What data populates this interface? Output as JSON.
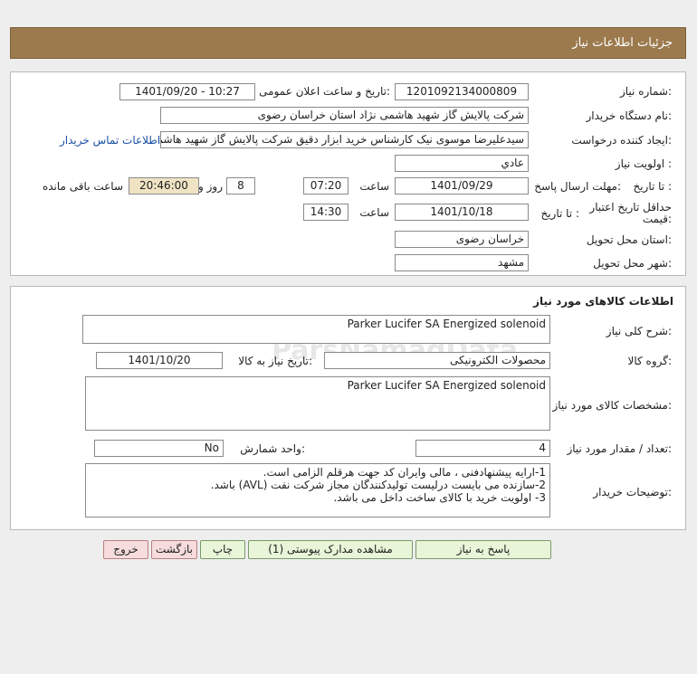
{
  "page_title": "جزئیات اطلاعات نیاز",
  "info": {
    "need_number_label": "شماره نیاز:",
    "need_number": "1201092134000809",
    "announce_label": "تاریخ و ساعت اعلان عمومی:",
    "announce_value": "1401/09/20 - 10:27",
    "buyer_label": "نام دستگاه خریدار:",
    "buyer_value": "شرکت پالایش گاز شهید هاشمی نژاد   استان خراسان رضوی",
    "creator_label": "ایجاد کننده درخواست:",
    "creator_value": "سیدعلیرضا موسوی نیک کارشناس خرید ابزار دقیق شرکت پالایش گاز شهید هاشمی نژاد",
    "contact_link": "اطلاعات تماس خریدار",
    "priority_label": "اولویت نیاز :",
    "priority_value": "عادي",
    "deadline_label": "مهلت ارسال پاسخ:",
    "until_date_label": "تا تاریخ :",
    "deadline_date": "1401/09/29",
    "time_label": "ساعت",
    "deadline_time": "07:20",
    "days_value": "8",
    "days_label": "روز و",
    "remaining_time": "20:46:00",
    "remaining_label": "ساعت باقی مانده",
    "validity_label": "حداقل تاریخ اعتبار قیمت:",
    "validity_date": "1401/10/18",
    "validity_time": "14:30",
    "province_label": "استان محل تحویل:",
    "province_value": "خراسان رضوی",
    "city_label": "شهر محل تحویل:",
    "city_value": "مشهد"
  },
  "goods": {
    "section_title": "اطلاعات کالاهای مورد نیاز",
    "summary_label": "شرح کلی نیاز:",
    "summary_value": "Parker Lucifer SA Energized solenoid",
    "group_label": "گروه کالا:",
    "group_value": "محصولات الکترونیکی",
    "need_date_label": "تاریخ نیاز به کالا:",
    "need_date_value": "1401/10/20",
    "spec_label": "مشخصات کالای مورد نیاز:",
    "spec_value": "Parker Lucifer SA Energized solenoid",
    "qty_label": "تعداد / مقدار مورد نیاز:",
    "qty_value": "4",
    "unit_label": "واحد شمارش:",
    "unit_value": "No",
    "notes_label": "توضیحات خریدار:",
    "notes_line1": "1-ارایه پیشنهادفنی ، مالی وایران کد جهت هرقلم الزامی است.",
    "notes_line2": "2-سازنده می بایست درلیست تولیدکنندگان مجاز شرکت نفت (AVL)  باشد.",
    "notes_line3": "3- اولویت خرید  با کالای ساخت  داخل می باشد."
  },
  "buttons": {
    "reply": "پاسخ به نیاز",
    "attachments": "مشاهده مدارک پیوستی (1)",
    "print": "چاپ",
    "back": "بازگشت",
    "exit": "خروج"
  },
  "colors": {
    "header": "#9c7a4e",
    "green_button": "#e8f5d8",
    "red_button": "#f6dcdc",
    "remaining_box": "#efe3c3",
    "link": "#1a4fa3"
  }
}
